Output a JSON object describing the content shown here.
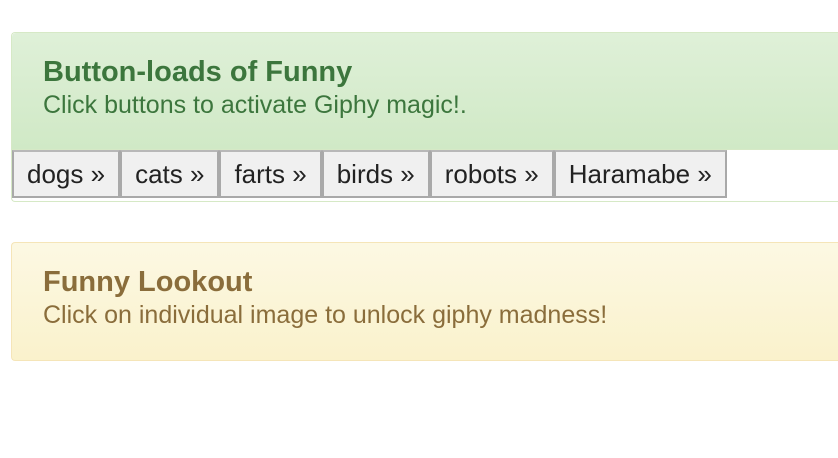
{
  "top_panel": {
    "title": "Button-loads of Funny",
    "subtitle": "Click buttons to activate Giphy magic!."
  },
  "topic_buttons": [
    {
      "label": "dogs »"
    },
    {
      "label": "cats »"
    },
    {
      "label": "farts »"
    },
    {
      "label": "birds »"
    },
    {
      "label": "robots »"
    },
    {
      "label": "Haramabe »"
    }
  ],
  "bottom_panel": {
    "title": "Funny Lookout",
    "subtitle": "Click on individual image to unlock giphy madness!"
  },
  "colors": {
    "success_text": "#3c763d",
    "success_bg": "#dff0d8",
    "warning_text": "#8a6d3b",
    "warning_bg": "#fcf8e3",
    "button_bg": "#f0f0f0"
  }
}
